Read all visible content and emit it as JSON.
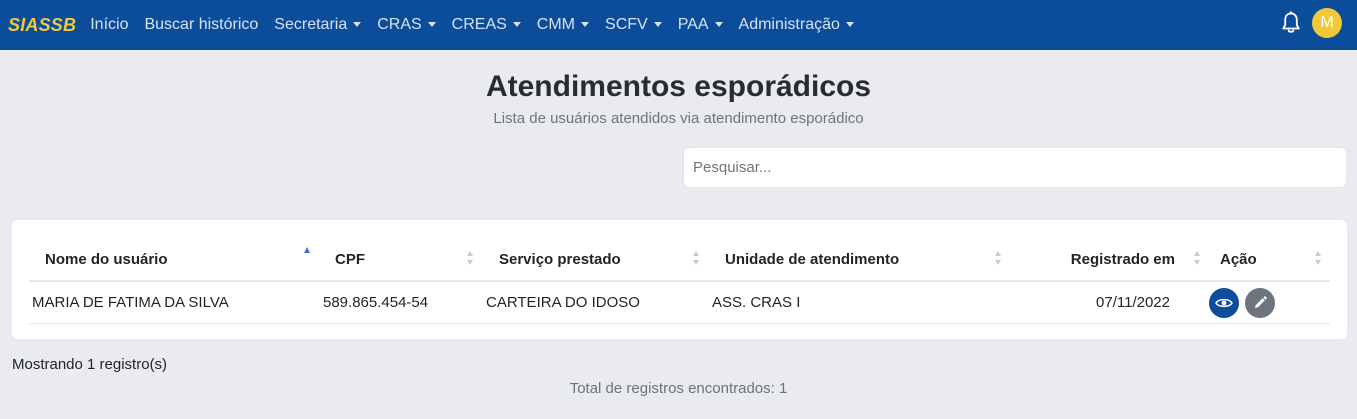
{
  "navbar": {
    "brand": "SIASSB",
    "items": [
      {
        "label": "Início",
        "dropdown": false
      },
      {
        "label": "Buscar histórico",
        "dropdown": false
      },
      {
        "label": "Secretaria",
        "dropdown": true
      },
      {
        "label": "CRAS",
        "dropdown": true
      },
      {
        "label": "CREAS",
        "dropdown": true
      },
      {
        "label": "CMM",
        "dropdown": true
      },
      {
        "label": "SCFV",
        "dropdown": true
      },
      {
        "label": "PAA",
        "dropdown": true
      },
      {
        "label": "Administração",
        "dropdown": true
      }
    ],
    "notifications_icon": "bell-icon",
    "avatar_initial": "M"
  },
  "page": {
    "title": "Atendimentos esporádicos",
    "subtitle": "Lista de usuários atendidos via atendimento esporádico"
  },
  "search": {
    "placeholder": "Pesquisar...",
    "value": ""
  },
  "table": {
    "columns": [
      "Nome do usuário",
      "CPF",
      "Serviço prestado",
      "Unidade de atendimento",
      "Registrado em",
      "Ação"
    ],
    "sorted_column": "Nome do usuário",
    "sort_direction": "asc",
    "rows": [
      {
        "nome": "MARIA DE FATIMA DA SILVA",
        "cpf": "589.865.454-54",
        "servico": "CARTEIRA DO IDOSO",
        "unidade": "ASS. CRAS I",
        "registrado": "07/11/2022",
        "actions": [
          "eye-icon",
          "pencil-icon"
        ]
      }
    ]
  },
  "footer": {
    "showing": "Mostrando 1 registro(s)",
    "total": "Total de registros encontrados: 1"
  },
  "colors": {
    "navbar": "#0b4d9a",
    "brand": "#f0c93a",
    "background": "#e9ebef",
    "view_button": "#0b4d9a",
    "edit_button": "#6c757d",
    "sort_active": "#3d6fd8"
  }
}
